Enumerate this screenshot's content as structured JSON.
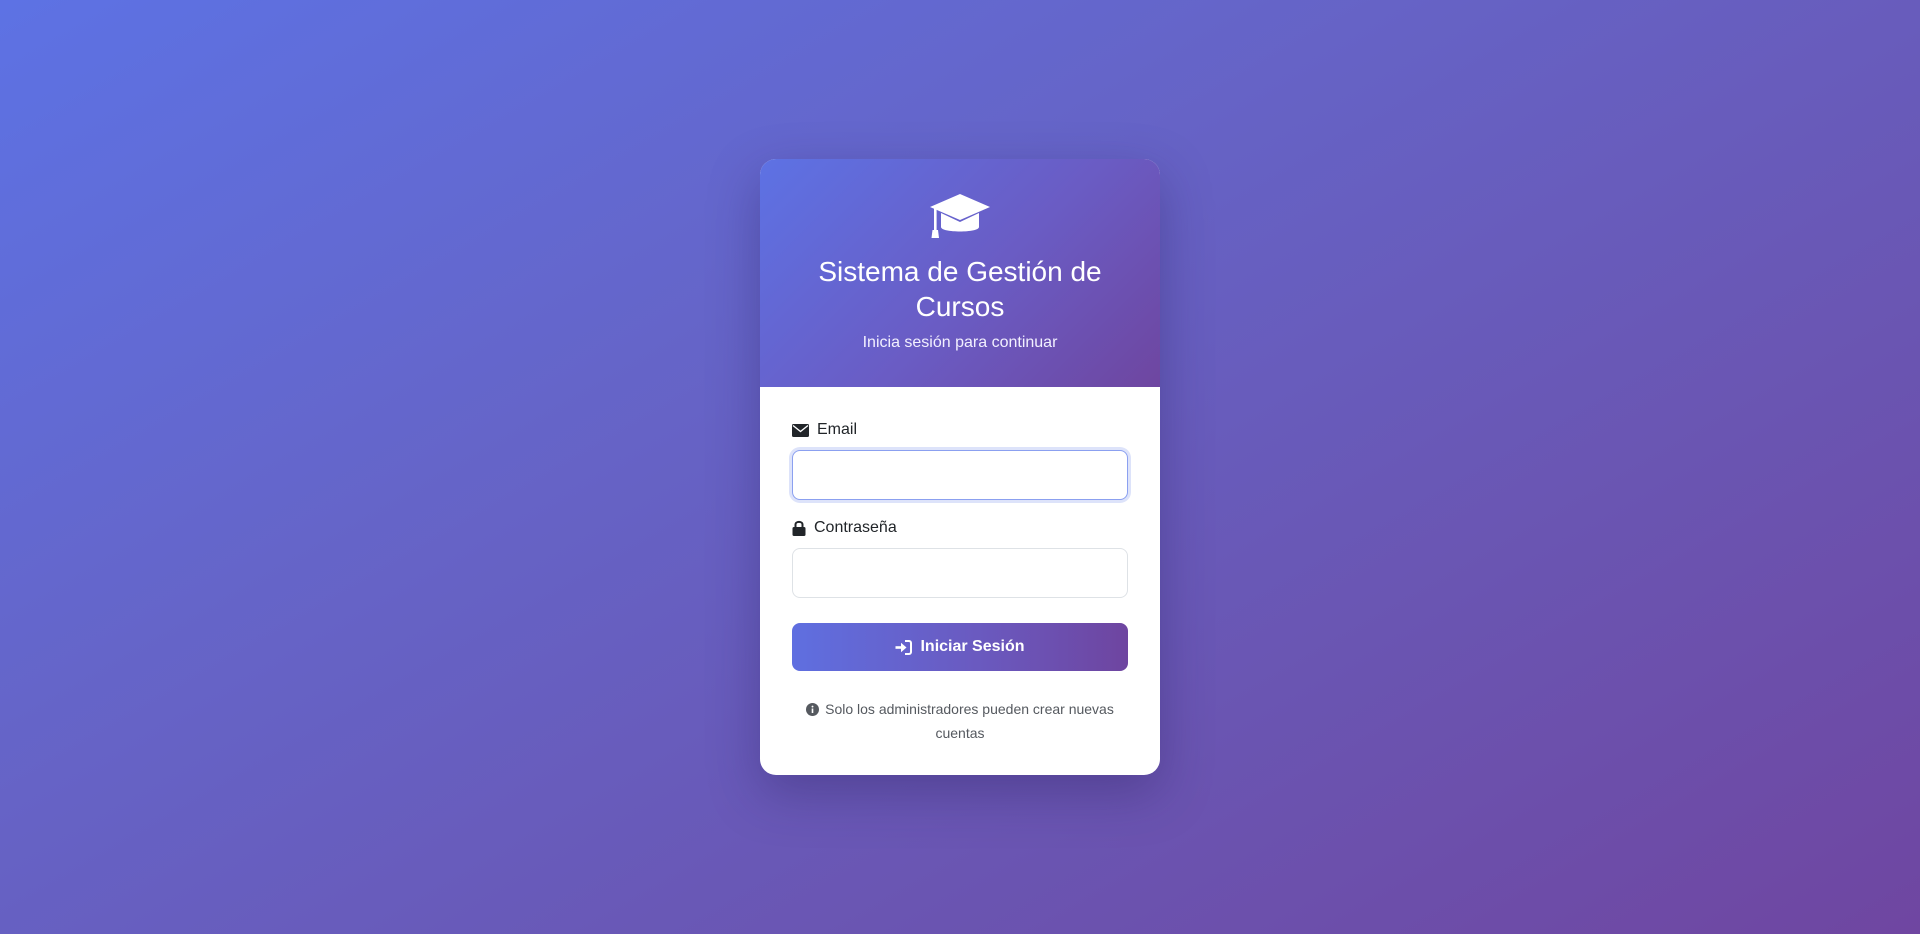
{
  "header": {
    "icon": "graduation-cap-icon",
    "title": "Sistema de Gestión de Cursos",
    "subtitle": "Inicia sesión para continuar"
  },
  "form": {
    "email": {
      "icon": "envelope-icon",
      "label": "Email",
      "value": "",
      "placeholder": ""
    },
    "password": {
      "icon": "lock-icon",
      "label": "Contraseña",
      "value": "",
      "placeholder": ""
    },
    "submit": {
      "icon": "sign-in-icon",
      "label": "Iniciar Sesión"
    }
  },
  "note": {
    "icon": "info-circle-icon",
    "text": "Solo los administradores pueden crear nuevas cuentas"
  },
  "colors": {
    "gradient_start": "#5d72e4",
    "gradient_end": "#6f46a1",
    "card_background": "#ffffff"
  }
}
